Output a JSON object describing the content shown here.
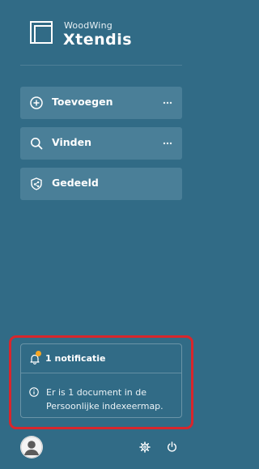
{
  "brand": {
    "top": "WoodWing",
    "main": "Xtendis"
  },
  "nav": {
    "items": [
      {
        "label": "Toevoegen",
        "icon": "plus-circle-icon"
      },
      {
        "label": "Vinden",
        "icon": "search-icon"
      },
      {
        "label": "Gedeeld",
        "icon": "shared-shield-icon"
      }
    ]
  },
  "notifications": {
    "title": "1 notificatie",
    "message": "Er is 1 document in de Persoonlijke indexeermap.",
    "badge_color": "#f5a623",
    "highlight_color": "#d8262c"
  },
  "footer": {
    "avatar_icon": "user-avatar-icon",
    "settings_icon": "gear-icon",
    "power_icon": "power-icon"
  },
  "colors": {
    "background": "#316b86",
    "button": "#4a7f98"
  }
}
